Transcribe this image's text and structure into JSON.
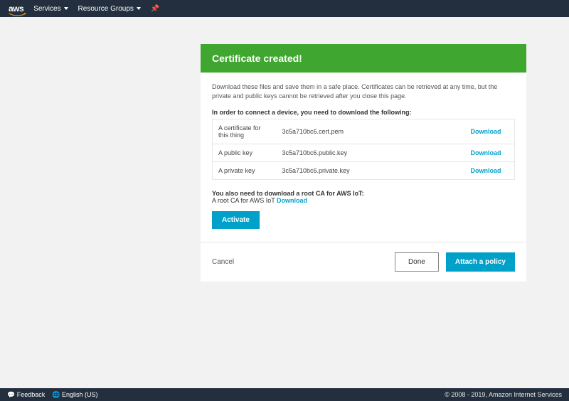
{
  "nav": {
    "logo": "aws",
    "services": "Services",
    "resource_groups": "Resource Groups"
  },
  "card": {
    "title": "Certificate created!",
    "description": "Download these files and save them in a safe place. Certificates can be retrieved at any time, but the private and public keys cannot be retrieved after you close this page.",
    "instruction": "In order to connect a device, you need to download the following:",
    "rows": [
      {
        "label": "A certificate for this thing",
        "file": "3c5a710bc6.cert.pem",
        "link": "Download"
      },
      {
        "label": "A public key",
        "file": "3c5a710bc6.public.key",
        "link": "Download"
      },
      {
        "label": "A private key",
        "file": "3c5a710bc6.private.key",
        "link": "Download"
      }
    ],
    "rootca": {
      "bold": "You also need to download a root CA for AWS IoT:",
      "text": "A root CA for AWS IoT ",
      "link": "Download"
    },
    "activate": "Activate"
  },
  "footer": {
    "cancel": "Cancel",
    "done": "Done",
    "attach": "Attach a policy"
  },
  "bottom": {
    "feedback": "Feedback",
    "language": "English (US)",
    "copyright": "© 2008 - 2019, Amazon Internet Services"
  }
}
